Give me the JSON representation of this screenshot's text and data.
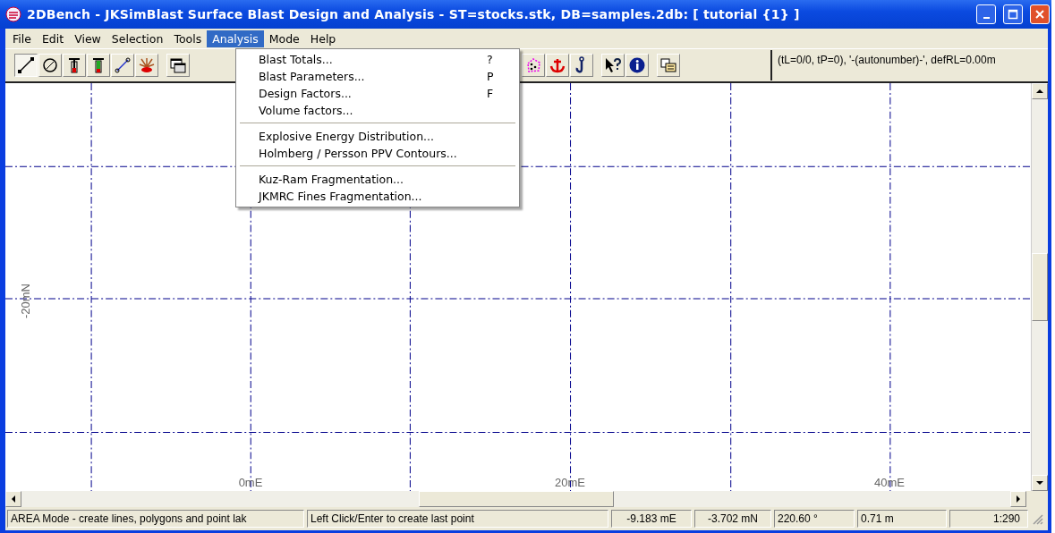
{
  "window": {
    "title": "2DBench - JKSimBlast Surface Blast Design and Analysis - ST=stocks.stk, DB=samples.2db: [ tutorial {1} ]"
  },
  "menu_bar": [
    {
      "label": "File",
      "selected": false
    },
    {
      "label": "Edit",
      "selected": false
    },
    {
      "label": "View",
      "selected": false
    },
    {
      "label": "Selection",
      "selected": false
    },
    {
      "label": "Tools",
      "selected": false
    },
    {
      "label": "Analysis",
      "selected": true
    },
    {
      "label": "Mode",
      "selected": false
    },
    {
      "label": "Help",
      "selected": false
    }
  ],
  "toolbar": [
    {
      "kind": "line",
      "pressed": true
    },
    {
      "kind": "circle",
      "pressed": false
    },
    {
      "kind": "hole-red",
      "pressed": false
    },
    {
      "kind": "hole-green",
      "pressed": false
    },
    {
      "kind": "segment",
      "pressed": false
    },
    {
      "kind": "blast",
      "pressed": false
    },
    {
      "kind": "gap"
    },
    {
      "kind": "window",
      "pressed": false
    },
    {
      "kind": "gap-hidden"
    },
    {
      "kind": "dots",
      "pressed": false
    },
    {
      "kind": "anchor",
      "pressed": false
    },
    {
      "kind": "hook",
      "pressed": false
    },
    {
      "kind": "gap"
    },
    {
      "kind": "help",
      "pressed": false
    },
    {
      "kind": "info",
      "pressed": false
    },
    {
      "kind": "gap"
    },
    {
      "kind": "copy",
      "pressed": false
    }
  ],
  "info_panel": "(tL=0/0, tP=0), '-(autonumber)-', defRL=0.00m",
  "dropdown": {
    "groups": [
      {
        "items": [
          {
            "label": "Blast Totals...",
            "shortcut": "?"
          },
          {
            "label": "Blast Parameters...",
            "shortcut": "P"
          },
          {
            "label": "Design Factors...",
            "shortcut": "F"
          },
          {
            "label": "Volume factors..."
          }
        ]
      },
      {
        "items": [
          {
            "label": "Explosive Energy Distribution..."
          },
          {
            "label": "Holmberg / Persson PPV Contours..."
          }
        ]
      },
      {
        "items": [
          {
            "label": "Kuz-Ram Fragmentation..."
          },
          {
            "label": "JKMRC Fines Fragmentation..."
          }
        ]
      }
    ]
  },
  "canvas": {
    "x_labels": [
      "0mE",
      "20mE",
      "40mE"
    ],
    "y_labels": [
      "-20mN"
    ]
  },
  "status_bar": [
    "AREA Mode - create lines, polygons and point lak",
    "Left Click/Enter to create last point",
    "-9.183 mE",
    "-3.702 mN",
    "220.60 °",
    "0.71 m",
    "1:290"
  ]
}
